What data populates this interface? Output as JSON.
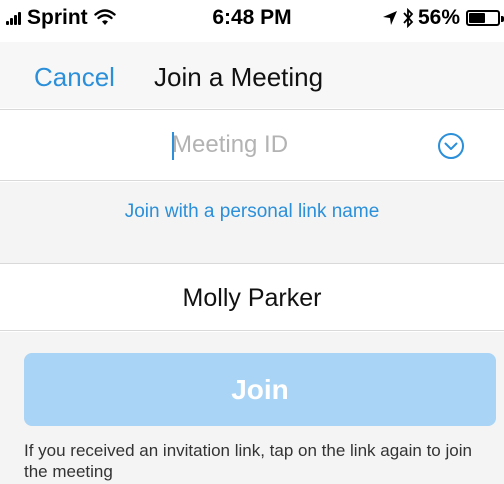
{
  "status_bar": {
    "carrier": "Sprint",
    "time": "6:48 PM",
    "battery": "56%",
    "battery_level": 0.56,
    "icons": [
      "signal-icon",
      "wifi-icon",
      "location-icon",
      "bluetooth-icon",
      "battery-icon"
    ]
  },
  "nav": {
    "cancel_label": "Cancel",
    "title": "Join a Meeting"
  },
  "meeting_id": {
    "value": "",
    "placeholder": "Meeting ID"
  },
  "personal_link_label": "Join with a personal link name",
  "name": {
    "value": "Molly Parker"
  },
  "join_label": "Join",
  "hint": "If you received an invitation link, tap on the link again to join the meeting",
  "colors": {
    "accent": "#2b8fd9",
    "join_button": "#a9d4f5",
    "background_gray": "#f4f4f4"
  }
}
